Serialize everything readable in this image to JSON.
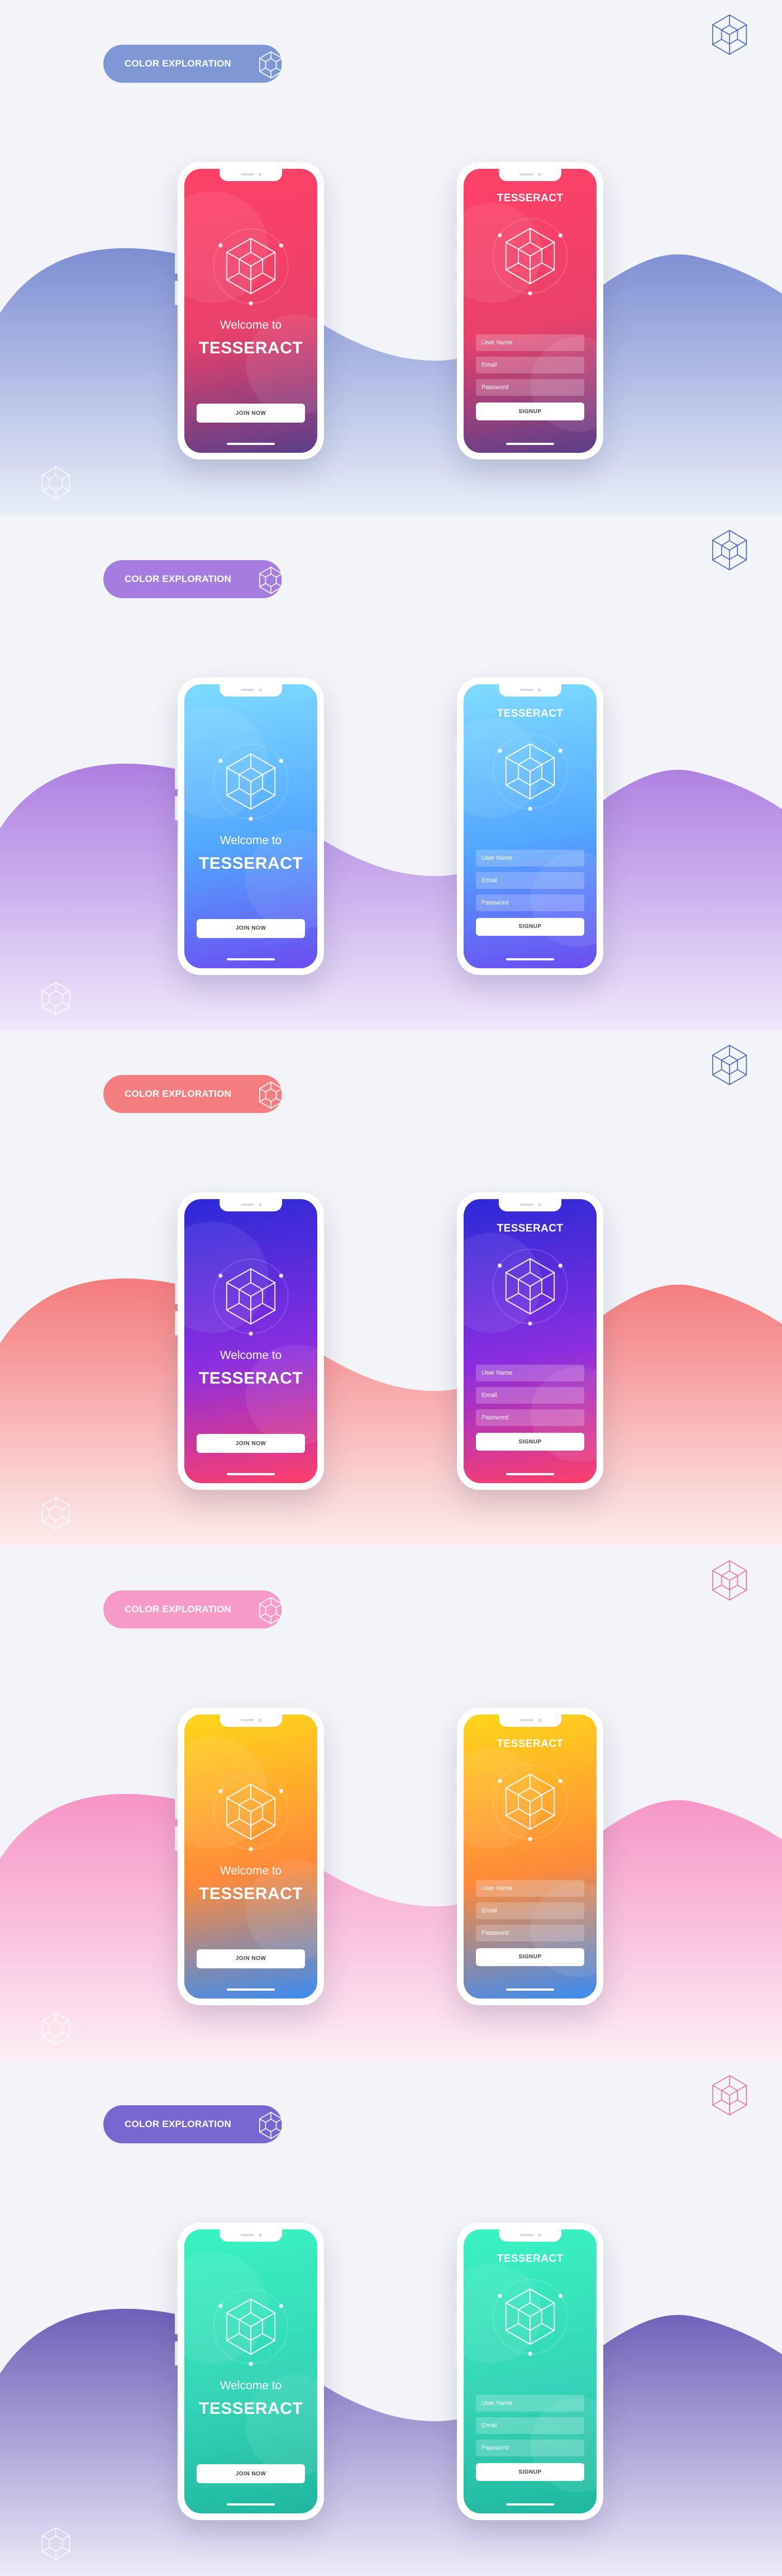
{
  "brand_name": "TESSERACT",
  "welcome_text": "Welcome to",
  "join_label": "JOIN NOW",
  "signup_label": "SIGNUP",
  "fields": [
    "User Name",
    "Email",
    "Password"
  ],
  "tag_label": "COLOR EXPLORATION",
  "icons": {
    "corner": "cube-outline-icon",
    "tag": "cube-outline-icon",
    "screen": "cube-outline-icon",
    "bottom": "cube-outline-icon"
  },
  "sections": [
    {
      "pill_color": "#7e98d6",
      "wave_top": "#7d8fd3",
      "wave_bottom": "#e9eef8",
      "corner_cube_color": "#4a6cc8",
      "screen_gradient": [
        "#ff4167",
        "#e9416a",
        "#5a3f8a"
      ]
    },
    {
      "pill_color": "#a57de0",
      "wave_top": "#ad7fe0",
      "wave_bottom": "#efe8fb",
      "corner_cube_color": "#4a6cc8",
      "screen_gradient": [
        "#7fdcff",
        "#52a6ff",
        "#6b4cf0"
      ]
    },
    {
      "pill_color": "#f47d80",
      "wave_top": "#f47b7c",
      "wave_bottom": "#fcecec",
      "corner_cube_color": "#4a6cc8",
      "screen_gradient": [
        "#2a2ad6",
        "#8a2ee0",
        "#ff3f6a"
      ]
    },
    {
      "pill_color": "#f69ac7",
      "wave_top": "#f595c6",
      "wave_bottom": "#fdeef5",
      "corner_cube_color": "#e87aa5",
      "screen_gradient": [
        "#ffd51a",
        "#ff8a3a",
        "#3a8bf2"
      ]
    },
    {
      "pill_color": "#7a66d1",
      "wave_top": "#6f5fb8",
      "wave_bottom": "#eceaf8",
      "corner_cube_color": "#e87aa5",
      "screen_gradient": [
        "#38f3c2",
        "#36d5b7",
        "#1fb79d"
      ]
    }
  ]
}
